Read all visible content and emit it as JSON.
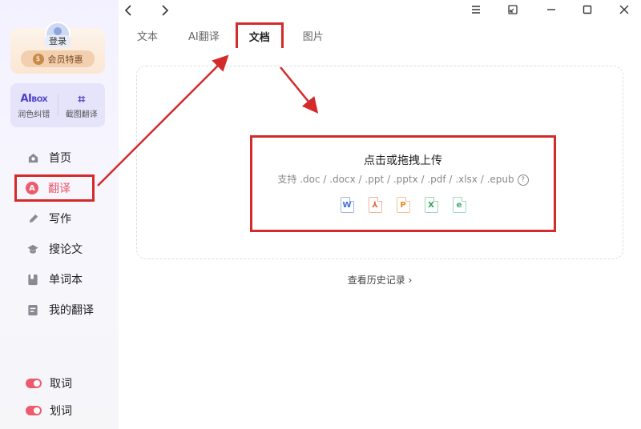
{
  "sidebar": {
    "login_label": "登录",
    "vip_label": "会员特惠",
    "tools": [
      {
        "label": "润色纠错",
        "icon": "aibox-icon",
        "logo_text": "AI",
        "logo_suffix": "BOX"
      },
      {
        "label": "截图翻译",
        "icon": "crop-icon"
      }
    ],
    "nav": [
      {
        "label": "首页",
        "icon": "home-icon"
      },
      {
        "label": "翻译",
        "icon": "translate-icon",
        "active": true
      },
      {
        "label": "写作",
        "icon": "pen-icon"
      },
      {
        "label": "搜论文",
        "icon": "graduation-cap-icon"
      },
      {
        "label": "单词本",
        "icon": "book-icon"
      },
      {
        "label": "我的翻译",
        "icon": "document-icon"
      }
    ],
    "toggles": [
      {
        "label": "取词",
        "on": true
      },
      {
        "label": "划词",
        "on": true
      }
    ]
  },
  "tabs": [
    {
      "label": "文本"
    },
    {
      "label": "AI翻译"
    },
    {
      "label": "文档",
      "active": true
    },
    {
      "label": "图片"
    }
  ],
  "upload": {
    "title": "点击或拖拽上传",
    "supported": "支持 .doc / .docx / .ppt / .pptx / .pdf / .xlsx / .epub",
    "help": "?",
    "file_types": [
      {
        "name": "word-file-icon",
        "glyph": "W",
        "color": "#3b6fd8"
      },
      {
        "name": "pdf-file-icon",
        "glyph": "⅄",
        "color": "#e0653a"
      },
      {
        "name": "ppt-file-icon",
        "glyph": "P",
        "color": "#e58a2d"
      },
      {
        "name": "excel-file-icon",
        "glyph": "X",
        "color": "#2f9e56"
      },
      {
        "name": "epub-file-icon",
        "glyph": "e",
        "color": "#3aa86b"
      }
    ]
  },
  "history_link": "查看历史记录 ›",
  "colors": {
    "accent": "#ee5a6d",
    "annotation": "#d42a2a"
  }
}
